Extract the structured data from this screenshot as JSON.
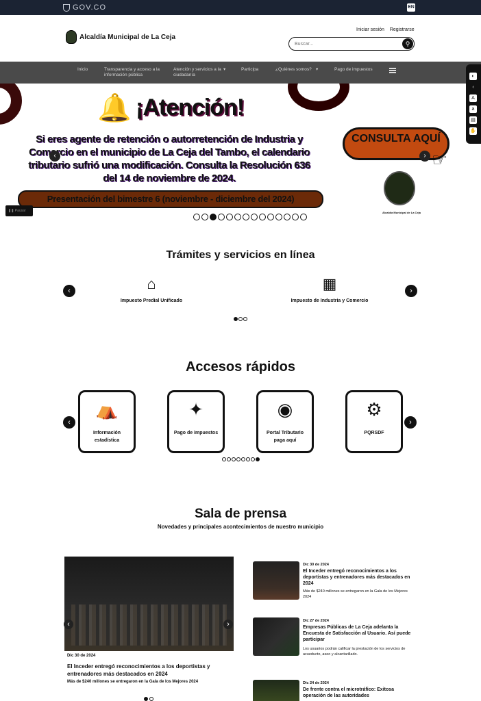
{
  "govbar": {
    "logo": "GOV.CO",
    "lang": "EN"
  },
  "header": {
    "site_name": "Alcaldía Municipal de La Ceja",
    "login": "Iniciar sesión",
    "register": "Registrarse",
    "search_placeholder": "Buscar..."
  },
  "nav": {
    "items": [
      {
        "label": "Inicio"
      },
      {
        "label": "Transparencia y acceso a la información pública"
      },
      {
        "label": "Atención y servicios a la ciudadanía"
      },
      {
        "label": "Participa"
      },
      {
        "label": "¿Quiénes somos?"
      },
      {
        "label": "Pago de impuestos"
      }
    ]
  },
  "hero": {
    "heading": "¡Atención!",
    "body": "Si eres agente de retención o autorretención de Industria y Comercio en el municipio de La Ceja del Tambo, el calendario tributario sufrió una modificación. Consulta la Resolución 636 del 14 de noviembre de 2024.",
    "cta": "CONSULTA AQUÍ",
    "period": "Presentación del bimestre 6 (noviembre - diciembre del 2024)",
    "pause_label": "Pausar",
    "slide_count": 14,
    "active_slide": 3
  },
  "tramites": {
    "title": "Trámites y servicios en línea",
    "items": [
      {
        "label": "Impuesto Predial Unificado",
        "icon": "home-icon"
      },
      {
        "label": "Impuesto de Industria y Comercio",
        "icon": "calculator-icon"
      }
    ],
    "page_count": 3,
    "active_page": 1
  },
  "accesos": {
    "title": "Accesos rápidos",
    "cards": [
      {
        "label": "Información estadística",
        "icon": "observatory-icon"
      },
      {
        "label": "Pago de impuestos",
        "icon": "click-pointer-icon"
      },
      {
        "label": "Portal Tributario paga aquí",
        "icon": "coins-icon"
      },
      {
        "label": "PQRSDF",
        "icon": "settings-folder-icon"
      }
    ],
    "page_count": 8,
    "active_page": 8
  },
  "prensa": {
    "title": "Sala de prensa",
    "subtitle": "Novedades y principales acontecimientos de nuestro municipio",
    "featured": {
      "date": "Dic 30 de 2024",
      "title": "El Inceder entregó reconocimientos a los deportistas y entrenadores más destacados en 2024",
      "summary": "Más de $240 millones se entregaron en la Gala de los Mejores 2024"
    },
    "news": [
      {
        "date": "Dic 30 de 2024",
        "title": "El Inceder entregó reconocimientos a los deportistas y entrenadores más destacados en 2024",
        "summary": "Más de $240 millones se entregaron en la Gala de los Mejores 2024"
      },
      {
        "date": "Dic 27 de 2024",
        "title": "Empresas Públicas de La Ceja adelanta la Encuesta de Satisfacción al Usuario. Así puede participar",
        "summary": "Los usuarios podrán calificar la prestación de los servicios de acueducto, aseo y alcantarillado."
      },
      {
        "date": "Dic 24 de 2024",
        "title": "De frente contra el microtráfico: Exitosa operación de las autoridades",
        "summary": ""
      }
    ]
  },
  "colors": {
    "govbar": "#1b2333",
    "nav": "#4a4a4a",
    "accent": "#c24a10"
  }
}
